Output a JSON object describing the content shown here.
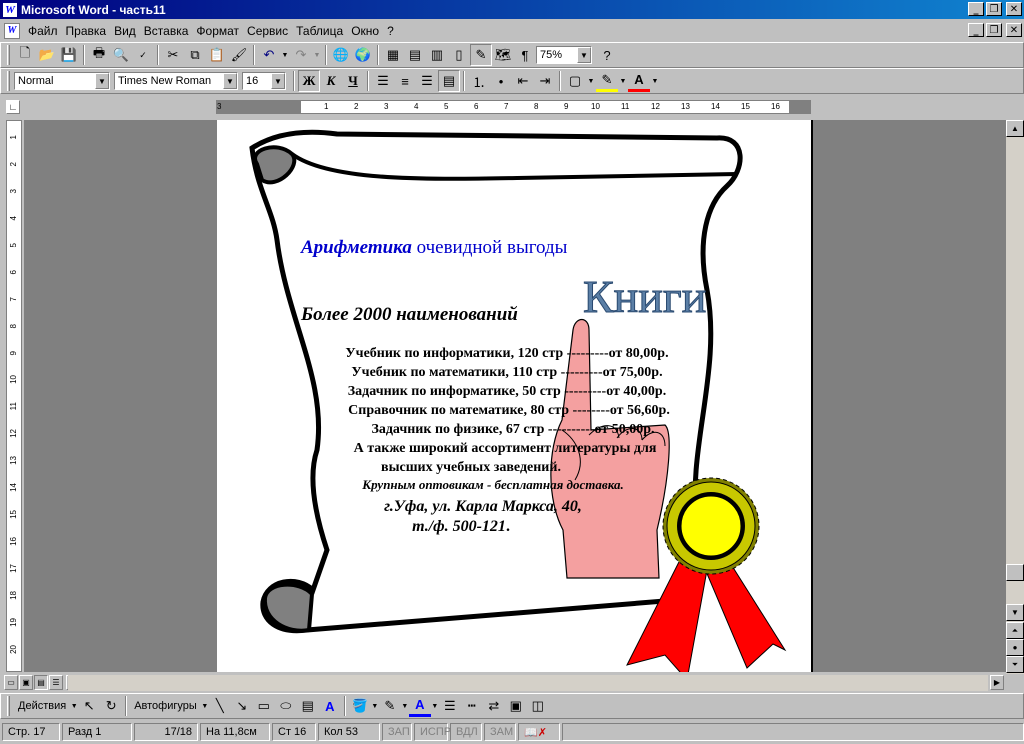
{
  "window": {
    "title": "Microsoft Word - часть11",
    "app_icon": "W"
  },
  "menu": [
    "Файл",
    "Правка",
    "Вид",
    "Вставка",
    "Формат",
    "Сервис",
    "Таблица",
    "Окно",
    "?"
  ],
  "standard_toolbar": {
    "zoom": "75%"
  },
  "formatting_toolbar": {
    "style": "Normal",
    "font": "Times New Roman",
    "size": "16",
    "bold": "Ж",
    "italic": "К",
    "underline": "Ч"
  },
  "ruler": {
    "h_numbers": [
      "3",
      "1",
      "2",
      "3",
      "4",
      "5",
      "6",
      "7",
      "8",
      "9",
      "10",
      "11",
      "12",
      "13",
      "14",
      "15",
      "16"
    ],
    "v_numbers": [
      "1",
      "2",
      "3",
      "4",
      "5",
      "6",
      "7",
      "8",
      "9",
      "10",
      "11",
      "12",
      "13",
      "14",
      "15",
      "16",
      "17",
      "18",
      "19",
      "20"
    ]
  },
  "document": {
    "heading_italic": "Арифметика",
    "heading_rest": " очевидной выгоды",
    "wordart": "Книги",
    "subheading": "Более 2000 наименований",
    "lines": [
      "Учебник по информатики, 120 стр ---------от 80,00р.",
      "Учебник по математики, 110 стр ---------от 75,00р.",
      "Задачник по информатике, 50 стр ---------от 40,00р.",
      "Справочник по математике, 80 стр --------от 56,60р.",
      "Задачник по физике, 67 стр ----------от 50,00р.",
      "А также широкий ассортимент литературы для",
      "высших учебных заведений."
    ],
    "wholesale": "Крупным оптовикам - бесплатная доставка.",
    "address": "г.Уфа, ул. Карла Маркса, 40,",
    "phone": "т./ф. 500-121",
    "phone_end": "."
  },
  "drawing_toolbar": {
    "actions": "Действия",
    "autoshapes": "Автофигуры"
  },
  "status": {
    "page": "Стр. 17",
    "section": "Разд 1",
    "pages": "17/18",
    "at": "На 11,8см",
    "line": "Ст 16",
    "col": "Кол 53",
    "rec": "ЗАП",
    "trk": "ИСПР",
    "ext": "ВДЛ",
    "ovr": "ЗАМ"
  },
  "colors": {
    "title_left": "#000080",
    "title_right": "#1084d0",
    "heading_blue": "#0000cc",
    "wordart": "#5b7fa6",
    "hand": "#f4a0a0",
    "ribbon": "#ff0000",
    "rosette": "#ffff00"
  }
}
